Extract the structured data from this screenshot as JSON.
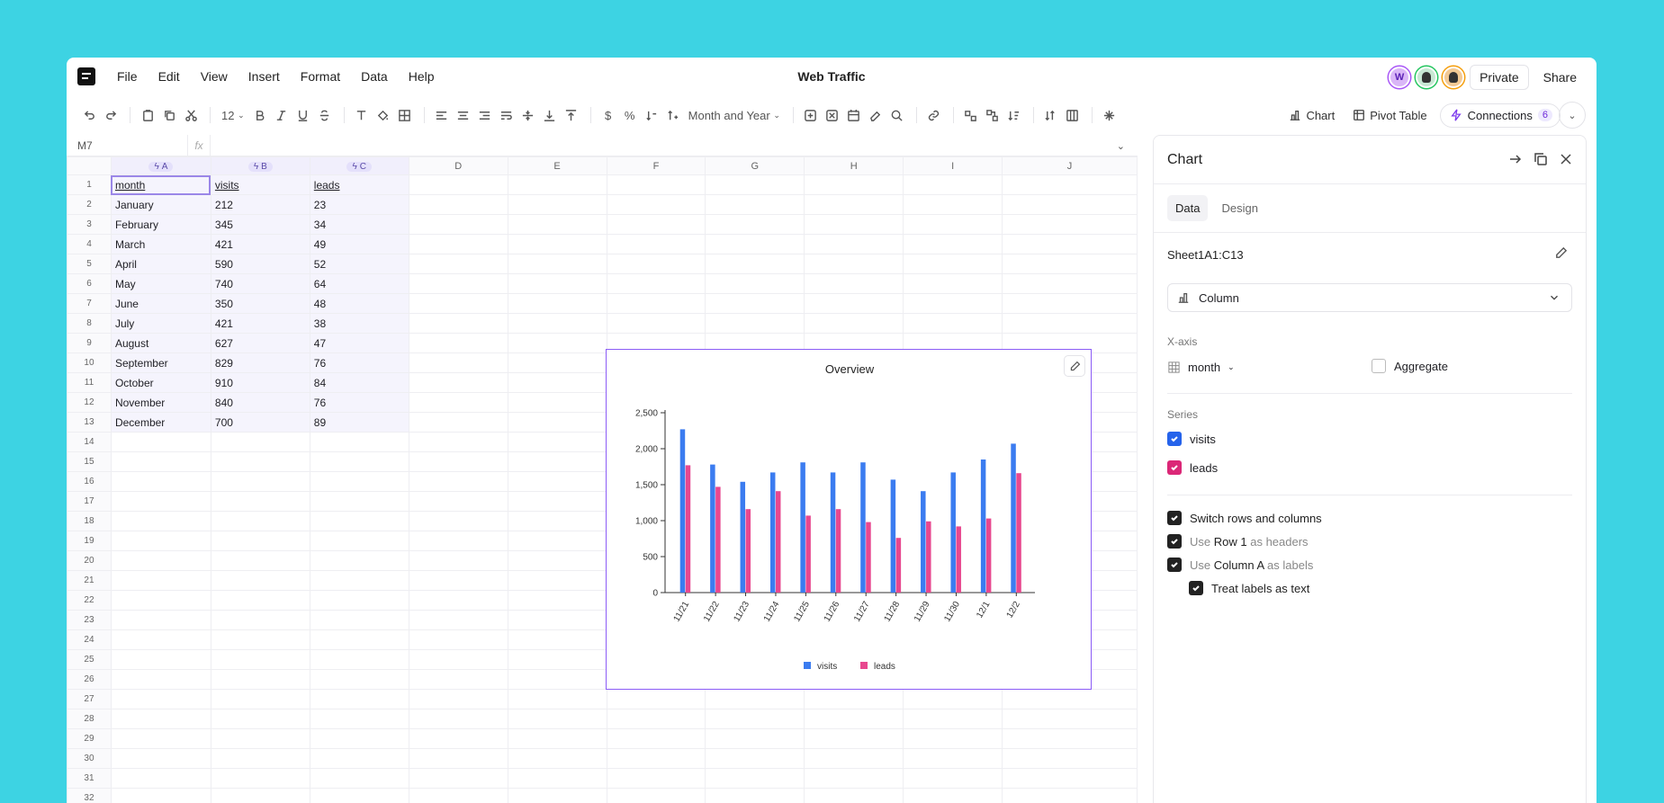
{
  "app": {
    "title": "Web Traffic",
    "menus": [
      "File",
      "Edit",
      "View",
      "Insert",
      "Format",
      "Data",
      "Help"
    ],
    "avatar_letter": "W",
    "private_label": "Private",
    "share_label": "Share"
  },
  "toolbar": {
    "font_size": "12",
    "date_format": "Month and Year",
    "chart_label": "Chart",
    "pivot_label": "Pivot Table",
    "connections_label": "Connections",
    "connections_count": "6"
  },
  "formula_bar": {
    "cell_ref": "M7",
    "fx": "fx"
  },
  "sheet": {
    "columns": [
      "A",
      "B",
      "C",
      "D",
      "E",
      "F",
      "G",
      "H",
      "I",
      "J"
    ],
    "row_numbers": [
      "1",
      "2",
      "3",
      "4",
      "5",
      "6",
      "7",
      "8",
      "9",
      "10",
      "11",
      "12",
      "13",
      "14",
      "15",
      "16",
      "17",
      "18",
      "19",
      "20",
      "21",
      "22",
      "23",
      "24",
      "25",
      "26",
      "27",
      "28",
      "29",
      "30",
      "31",
      "32"
    ],
    "header_row": [
      "month",
      "visits",
      "leads"
    ],
    "rows": [
      [
        "January",
        "212",
        "23"
      ],
      [
        "February",
        "345",
        "34"
      ],
      [
        "March",
        "421",
        "49"
      ],
      [
        "April",
        "590",
        "52"
      ],
      [
        "May",
        "740",
        "64"
      ],
      [
        "June",
        "350",
        "48"
      ],
      [
        "July",
        "421",
        "38"
      ],
      [
        "August",
        "627",
        "47"
      ],
      [
        "September",
        "829",
        "76"
      ],
      [
        "October",
        "910",
        "84"
      ],
      [
        "November",
        "840",
        "76"
      ],
      [
        "December",
        "700",
        "89"
      ]
    ]
  },
  "chart_data": {
    "type": "bar",
    "title": "Overview",
    "categories": [
      "11/21",
      "11/22",
      "11/23",
      "11/24",
      "11/25",
      "11/26",
      "11/27",
      "11/28",
      "11/29",
      "11/30",
      "12/1",
      "12/2"
    ],
    "series": [
      {
        "name": "visits",
        "color": "#3b7cf0",
        "values": [
          2270,
          1780,
          1540,
          1670,
          1810,
          1670,
          1810,
          1570,
          1410,
          1670,
          1850,
          2070
        ]
      },
      {
        "name": "leads",
        "color": "#e8488f",
        "values": [
          1770,
          1470,
          1160,
          1410,
          1070,
          1160,
          980,
          760,
          990,
          920,
          1030,
          1660
        ]
      }
    ],
    "yticks": [
      "0",
      "500",
      "1,000",
      "1,500",
      "2,000",
      "2,500"
    ],
    "ylim": [
      0,
      2500
    ],
    "legend": "bottom",
    "grid": false
  },
  "panel": {
    "title": "Chart",
    "tabs": [
      "Data",
      "Design"
    ],
    "range": "Sheet1A1:C13",
    "chart_type": "Column",
    "xaxis_label": "X-axis",
    "xaxis_value": "month",
    "aggregate_label": "Aggregate",
    "series_label": "Series",
    "series": [
      {
        "name": "visits",
        "color": "#2563eb"
      },
      {
        "name": "leads",
        "color": "#db2777"
      }
    ],
    "options": {
      "switch": "Switch rows and columns",
      "use1": "Use",
      "row1": "Row 1",
      "as_headers": "as headers",
      "use2": "Use",
      "colA": "Column A",
      "as_labels": "as labels",
      "treat": "Treat labels as text"
    }
  }
}
